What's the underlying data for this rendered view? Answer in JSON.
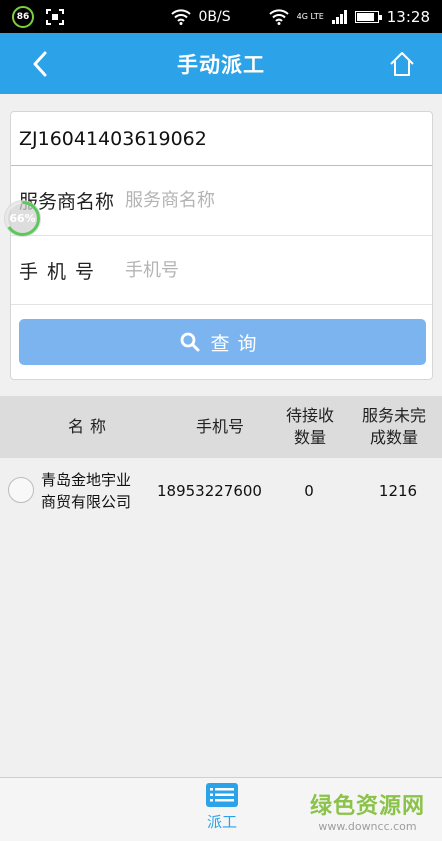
{
  "status_bar": {
    "battery_percent": "86",
    "net_speed": "0B/S",
    "network_type": "4G LTE",
    "time": "13:28"
  },
  "header": {
    "title": "手动派工",
    "back_icon": "chevron-left-icon",
    "home_icon": "home-icon"
  },
  "form": {
    "order_number": "ZJ16041403619062",
    "provider_name": {
      "label": "服务商名称",
      "placeholder": "服务商名称",
      "value": ""
    },
    "phone": {
      "label": "手机号",
      "placeholder": "手机号",
      "value": ""
    },
    "search_button": {
      "label": "查询",
      "icon": "search-icon"
    }
  },
  "floating_progress": {
    "text": "66%",
    "value": 0.66
  },
  "table": {
    "headers": {
      "name": "名称",
      "phone": "手机号",
      "pending_line1": "待接收",
      "pending_line2": "数量",
      "unfinished_line1": "服务未完",
      "unfinished_line2": "成数量"
    },
    "rows": [
      {
        "name_line1": "青岛金地宇业",
        "name_line2": "商贸有限公司",
        "phone": "18953227600",
        "pending": "0",
        "unfinished": "1216",
        "selected": false
      }
    ]
  },
  "bottom_nav": {
    "items": [
      {
        "label": "派工",
        "icon": "list-icon",
        "active": true
      }
    ]
  },
  "watermark": {
    "main": "绿色资源网",
    "sub": "www.downcc.com"
  },
  "colors": {
    "primary": "#2ca3e8",
    "search_button": "#7cb4ef",
    "watermark_green": "#8bc34a"
  }
}
